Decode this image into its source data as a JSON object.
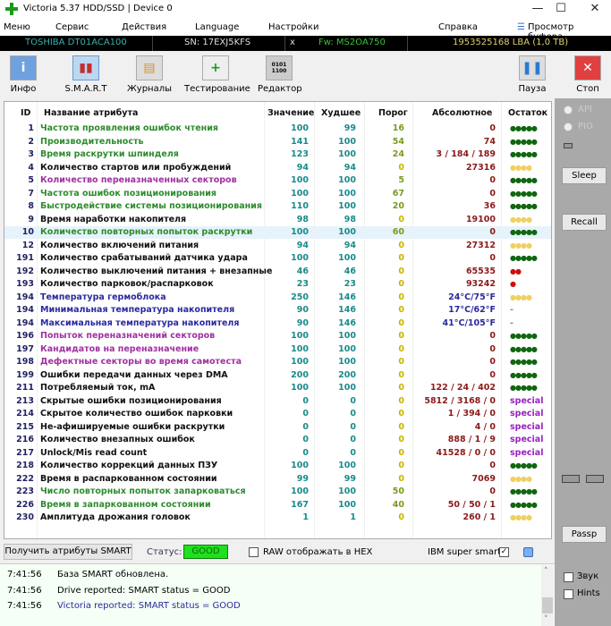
{
  "window": {
    "title": "Victoria 5.37 HDD/SSD | Device 0",
    "minimize": "—",
    "maximize": "☐",
    "close": "✕"
  },
  "menu": {
    "items": [
      "Меню",
      "Сервис",
      "Действия",
      "Language",
      "Настройки",
      "Справка"
    ],
    "buffer": "Просмотр буфера"
  },
  "drive": {
    "model": "TOSHIBA DT01ACA100",
    "serial": "SN: 17EXJ5KFS",
    "x": "x",
    "firmware": "Fw: MS2OA750",
    "lba": "1953525168 LBA (1,0 TB)"
  },
  "toolbar": {
    "info": "Инфо",
    "smart": "S.M.A.R.T",
    "logs": "Журналы",
    "test": "Тестирование",
    "editor": "Редактор",
    "pause": "Пауза",
    "stop": "Стоп"
  },
  "table": {
    "headers": {
      "id": "ID",
      "name": "Название атрибута",
      "value": "Значение",
      "worst": "Худшее",
      "threshold": "Порог",
      "raw": "Абсолютное",
      "remain": "Остаток"
    },
    "rows": [
      {
        "id": "1",
        "name": "Частота проявления ошибок чтения",
        "value": "100",
        "worst": "99",
        "threshold": "16",
        "raw": "0",
        "remain": "●●●●●",
        "nc": "green",
        "ac": "red",
        "rc": "green"
      },
      {
        "id": "2",
        "name": "Производительность",
        "value": "141",
        "worst": "100",
        "threshold": "54",
        "raw": "74",
        "remain": "●●●●●",
        "nc": "green",
        "ac": "red",
        "rc": "green"
      },
      {
        "id": "3",
        "name": "Время раскрутки шпинделя",
        "value": "123",
        "worst": "100",
        "threshold": "24",
        "raw": "3 / 184 / 189",
        "remain": "●●●●●",
        "nc": "green",
        "ac": "red",
        "rc": "green"
      },
      {
        "id": "4",
        "name": "Количество стартов или пробуждений",
        "value": "94",
        "worst": "94",
        "threshold": "0",
        "raw": "27316",
        "remain": "●●●●",
        "nc": "black",
        "ac": "red",
        "rc": "yellow"
      },
      {
        "id": "5",
        "name": "Количество переназначенных секторов",
        "value": "100",
        "worst": "100",
        "threshold": "5",
        "raw": "0",
        "remain": "●●●●●",
        "nc": "purple",
        "ac": "red",
        "rc": "green"
      },
      {
        "id": "7",
        "name": "Частота ошибок позиционирования",
        "value": "100",
        "worst": "100",
        "threshold": "67",
        "raw": "0",
        "remain": "●●●●●",
        "nc": "green",
        "ac": "red",
        "rc": "green"
      },
      {
        "id": "8",
        "name": "Быстродействие системы позиционирования",
        "value": "110",
        "worst": "100",
        "threshold": "20",
        "raw": "36",
        "remain": "●●●●●",
        "nc": "green",
        "ac": "red",
        "rc": "green"
      },
      {
        "id": "9",
        "name": "Время наработки накопителя",
        "value": "98",
        "worst": "98",
        "threshold": "0",
        "raw": "19100",
        "remain": "●●●●",
        "nc": "black",
        "ac": "red",
        "rc": "yellow"
      },
      {
        "id": "10",
        "name": "Количество повторных попыток раскрутки",
        "value": "100",
        "worst": "100",
        "threshold": "60",
        "raw": "0",
        "remain": "●●●●●",
        "nc": "green",
        "ac": "red",
        "rc": "green",
        "selected": true
      },
      {
        "id": "12",
        "name": "Количество включений питания",
        "value": "94",
        "worst": "94",
        "threshold": "0",
        "raw": "27312",
        "remain": "●●●●",
        "nc": "black",
        "ac": "red",
        "rc": "yellow"
      },
      {
        "id": "191",
        "name": "Количество срабатываний датчика удара",
        "value": "100",
        "worst": "100",
        "threshold": "0",
        "raw": "0",
        "remain": "●●●●●",
        "nc": "black",
        "ac": "red",
        "rc": "green"
      },
      {
        "id": "192",
        "name": "Количество выключений питания + внезапные",
        "value": "46",
        "worst": "46",
        "threshold": "0",
        "raw": "65535",
        "remain": "●●",
        "nc": "black",
        "ac": "red",
        "rc": "red"
      },
      {
        "id": "193",
        "name": "Количество парковок/распарковок",
        "value": "23",
        "worst": "23",
        "threshold": "0",
        "raw": "93242",
        "remain": "●",
        "nc": "black",
        "ac": "red",
        "rc": "red"
      },
      {
        "id": "194",
        "name": "Температура гермоблока",
        "value": "250",
        "worst": "146",
        "threshold": "0",
        "raw": "24°C/75°F",
        "remain": "●●●●",
        "nc": "blue",
        "ac": "blue",
        "rc": "yellow"
      },
      {
        "id": "194",
        "name": "Минимальная температура накопителя",
        "value": "90",
        "worst": "146",
        "threshold": "0",
        "raw": "17°C/62°F",
        "remain": "-",
        "nc": "blue",
        "ac": "blue",
        "rc": "dash"
      },
      {
        "id": "194",
        "name": "Максимальная температура накопителя",
        "value": "90",
        "worst": "146",
        "threshold": "0",
        "raw": "41°C/105°F",
        "remain": "-",
        "nc": "blue",
        "ac": "blue",
        "rc": "dash"
      },
      {
        "id": "196",
        "name": "Попыток переназначений секторов",
        "value": "100",
        "worst": "100",
        "threshold": "0",
        "raw": "0",
        "remain": "●●●●●",
        "nc": "purple",
        "ac": "red",
        "rc": "green"
      },
      {
        "id": "197",
        "name": "Кандидатов на переназначение",
        "value": "100",
        "worst": "100",
        "threshold": "0",
        "raw": "0",
        "remain": "●●●●●",
        "nc": "purple",
        "ac": "red",
        "rc": "green"
      },
      {
        "id": "198",
        "name": "Дефектные секторы во время самотеста",
        "value": "100",
        "worst": "100",
        "threshold": "0",
        "raw": "0",
        "remain": "●●●●●",
        "nc": "purple",
        "ac": "red",
        "rc": "green"
      },
      {
        "id": "199",
        "name": "Ошибки передачи данных через DMA",
        "value": "200",
        "worst": "200",
        "threshold": "0",
        "raw": "0",
        "remain": "●●●●●",
        "nc": "black",
        "ac": "red",
        "rc": "green"
      },
      {
        "id": "211",
        "name": "Потребляемый ток, mA",
        "value": "100",
        "worst": "100",
        "threshold": "0",
        "raw": "122 / 24 / 402",
        "remain": "●●●●●",
        "nc": "black",
        "ac": "red",
        "rc": "green"
      },
      {
        "id": "213",
        "name": "Скрытые ошибки позиционирования",
        "value": "0",
        "worst": "0",
        "threshold": "0",
        "raw": "5812 / 3168 / 0",
        "remain": "special",
        "nc": "black",
        "ac": "red",
        "rc": "special"
      },
      {
        "id": "214",
        "name": "Скрытое количество ошибок парковки",
        "value": "0",
        "worst": "0",
        "threshold": "0",
        "raw": "1 / 394 / 0",
        "remain": "special",
        "nc": "black",
        "ac": "red",
        "rc": "special"
      },
      {
        "id": "215",
        "name": "Не-афишируемые ошибки раскрутки",
        "value": "0",
        "worst": "0",
        "threshold": "0",
        "raw": "4 / 0",
        "remain": "special",
        "nc": "black",
        "ac": "red",
        "rc": "special"
      },
      {
        "id": "216",
        "name": "Количество внезапных ошибок",
        "value": "0",
        "worst": "0",
        "threshold": "0",
        "raw": "888 / 1 / 9",
        "remain": "special",
        "nc": "black",
        "ac": "red",
        "rc": "special"
      },
      {
        "id": "217",
        "name": "Unlock/Mis read count",
        "value": "0",
        "worst": "0",
        "threshold": "0",
        "raw": "41528 / 0 / 0",
        "remain": "special",
        "nc": "black",
        "ac": "red",
        "rc": "special"
      },
      {
        "id": "218",
        "name": "Количество коррекций данных ПЗУ",
        "value": "100",
        "worst": "100",
        "threshold": "0",
        "raw": "0",
        "remain": "●●●●●",
        "nc": "black",
        "ac": "red",
        "rc": "green"
      },
      {
        "id": "222",
        "name": "Время в распаркованном состоянии",
        "value": "99",
        "worst": "99",
        "threshold": "0",
        "raw": "7069",
        "remain": "●●●●",
        "nc": "black",
        "ac": "red",
        "rc": "yellow"
      },
      {
        "id": "223",
        "name": "Число повторных попыток запарковаться",
        "value": "100",
        "worst": "100",
        "threshold": "50",
        "raw": "0",
        "remain": "●●●●●",
        "nc": "green",
        "ac": "red",
        "rc": "green"
      },
      {
        "id": "226",
        "name": "Время в запаркованном состоянии",
        "value": "167",
        "worst": "100",
        "threshold": "40",
        "raw": "50 / 50 / 1",
        "remain": "●●●●●",
        "nc": "green",
        "ac": "red",
        "rc": "green"
      },
      {
        "id": "230",
        "name": "Амплитуда дрожания головок",
        "value": "1",
        "worst": "1",
        "threshold": "0",
        "raw": "260 / 1",
        "remain": "●●●●",
        "nc": "black",
        "ac": "red",
        "rc": "yellow"
      }
    ]
  },
  "bottom": {
    "get_smart": "Получить атрибуты SMART",
    "status_label": "Статус:",
    "status_value": "GOOD",
    "raw_hex": "RAW отображать в HEX",
    "ibm": "IBM super smart:",
    "ibm_check": "✓"
  },
  "right": {
    "api": "API",
    "pio": "PIO",
    "sleep": "Sleep",
    "recall": "Recall",
    "passp": "Passp",
    "sound": "Звук",
    "hints": "Hints"
  },
  "log": [
    {
      "time": "7:41:56",
      "msg": "База SMART обновлена."
    },
    {
      "time": "7:41:56",
      "msg": "Drive reported: SMART status = GOOD"
    },
    {
      "time": "7:41:56",
      "msg": "Victoria reported: SMART status = GOOD",
      "blue": true
    }
  ],
  "scroll": {
    "up": "˄",
    "down": "˅"
  }
}
